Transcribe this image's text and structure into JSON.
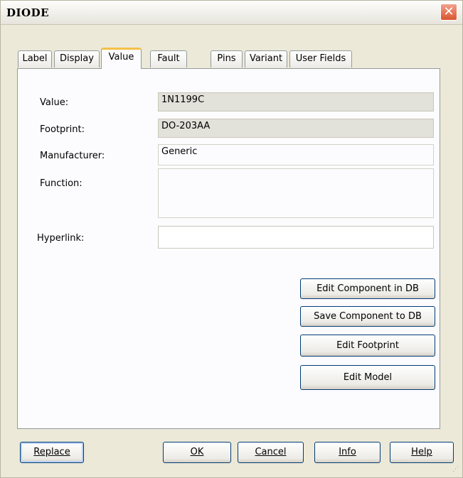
{
  "window": {
    "title": "DIODE"
  },
  "tabs": [
    {
      "label": "Label"
    },
    {
      "label": "Display"
    },
    {
      "label": "Value"
    },
    {
      "label": "Fault"
    },
    {
      "label": "Pins"
    },
    {
      "label": "Variant"
    },
    {
      "label": "User Fields"
    }
  ],
  "fields": {
    "value": {
      "label": "Value:",
      "value": "1N1199C"
    },
    "footprint": {
      "label": "Footprint:",
      "value": "DO-203AA"
    },
    "manufacturer": {
      "label": "Manufacturer:",
      "value": "Generic"
    },
    "function": {
      "label": "Function:",
      "value": ""
    },
    "hyperlink": {
      "label": "Hyperlink:",
      "value": ""
    }
  },
  "actions": {
    "edit_component_db": "Edit Component in DB",
    "save_component_db": "Save Component to DB",
    "edit_footprint": "Edit Footprint",
    "edit_model": "Edit Model"
  },
  "footer": {
    "replace": "Replace",
    "ok": "OK",
    "cancel": "Cancel",
    "info": "Info",
    "help": "Help"
  }
}
